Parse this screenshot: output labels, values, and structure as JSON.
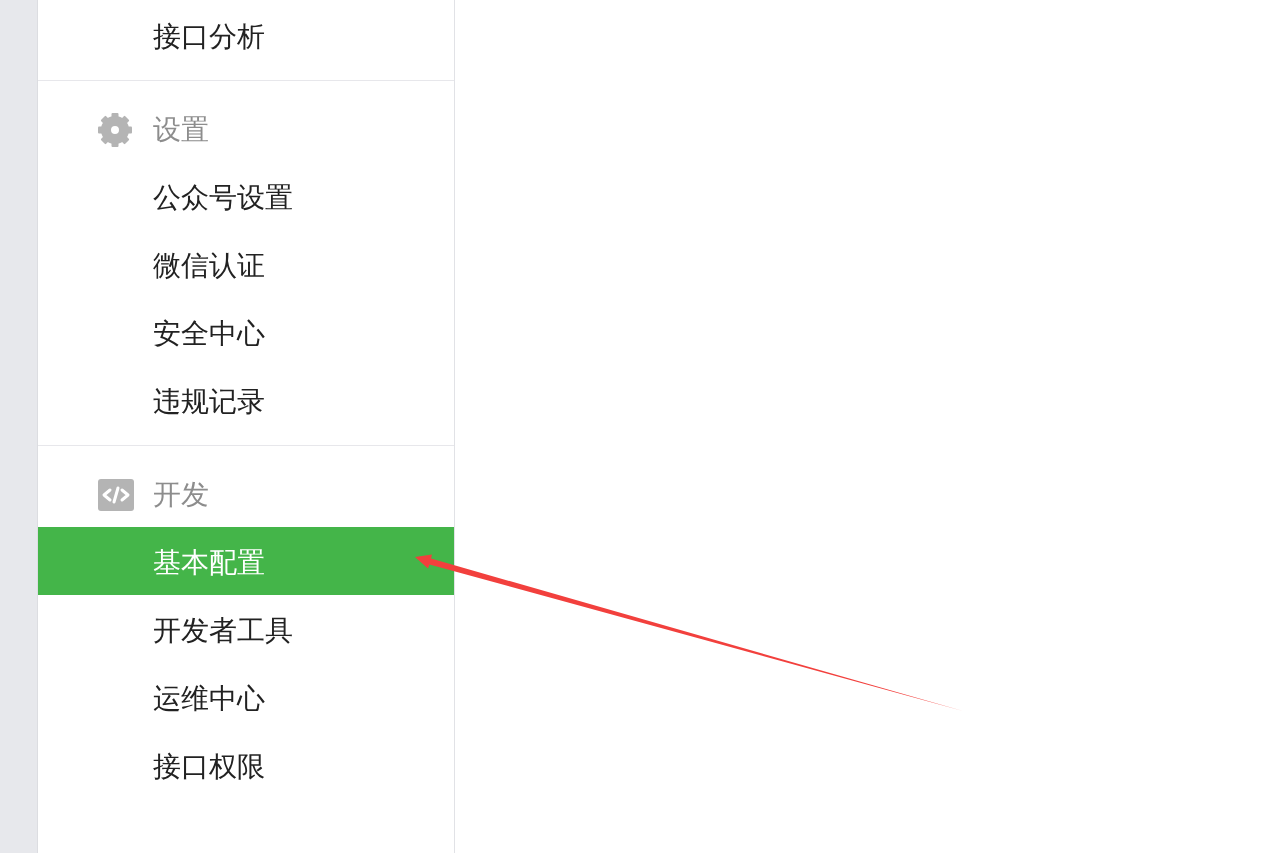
{
  "sidebar": {
    "sections": [
      {
        "items": [
          {
            "label": "接口分析",
            "selected": false
          }
        ]
      },
      {
        "header": "设置",
        "items": [
          {
            "label": "公众号设置",
            "selected": false
          },
          {
            "label": "微信认证",
            "selected": false
          },
          {
            "label": "安全中心",
            "selected": false
          },
          {
            "label": "违规记录",
            "selected": false
          }
        ]
      },
      {
        "header": "开发",
        "items": [
          {
            "label": "基本配置",
            "selected": true
          },
          {
            "label": "开发者工具",
            "selected": false
          },
          {
            "label": "运维中心",
            "selected": false
          },
          {
            "label": "接口权限",
            "selected": false
          }
        ]
      }
    ]
  }
}
